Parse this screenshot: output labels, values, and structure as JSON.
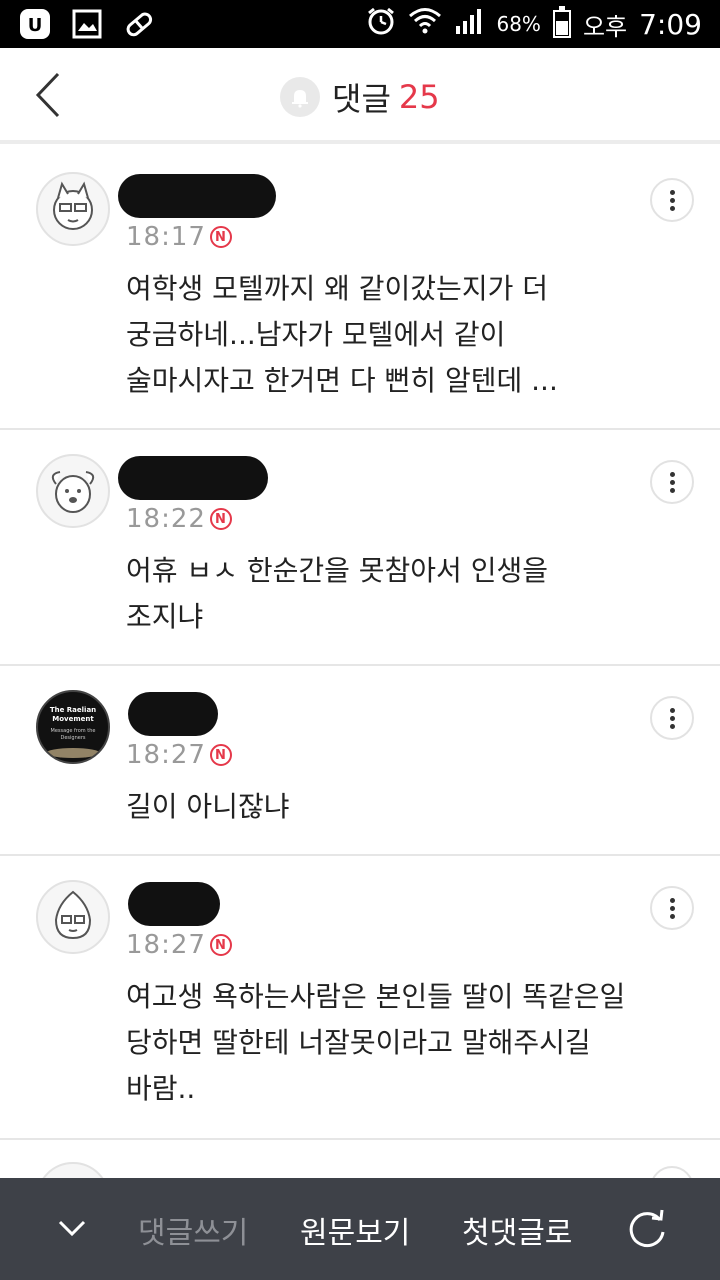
{
  "status_bar": {
    "battery_percent": "68%",
    "ampm": "오후",
    "time": "7:09",
    "left_icons": [
      "u-plus-icon",
      "gallery-icon",
      "pill-icon"
    ],
    "right_icons": [
      "alarm-icon",
      "wifi-icon",
      "signal-icon",
      "battery-icon"
    ]
  },
  "header": {
    "title": "댓글",
    "count": "25",
    "count_color": "#e5384a"
  },
  "comments": [
    {
      "time": "18:17",
      "badge": "N",
      "text": "여학생 모텔까지 왜 같이갔는지가 더\n궁금하네...남자가 모텔에서 같이\n술마시자고 한거면 다 뻔히 알텐데 ..."
    },
    {
      "time": "18:22",
      "badge": "N",
      "text": "어휴 ㅂㅅ 한순간을 못참아서 인생을\n조지냐"
    },
    {
      "time": "18:27",
      "badge": "N",
      "avatar_text": "The Raelian Movement",
      "avatar_subtext": "Message from the Designers",
      "text": "길이 아니잖냐"
    },
    {
      "time": "18:27",
      "badge": "N",
      "text": "여고생 욕하는사람은 본인들 딸이 똑같은일\n당하면 딸한테 너잘못이라고 말해주시길\n바람.."
    }
  ],
  "bottom_bar": {
    "write_label": "댓글쓰기",
    "original_label": "원문보기",
    "first_label": "첫댓글로"
  }
}
